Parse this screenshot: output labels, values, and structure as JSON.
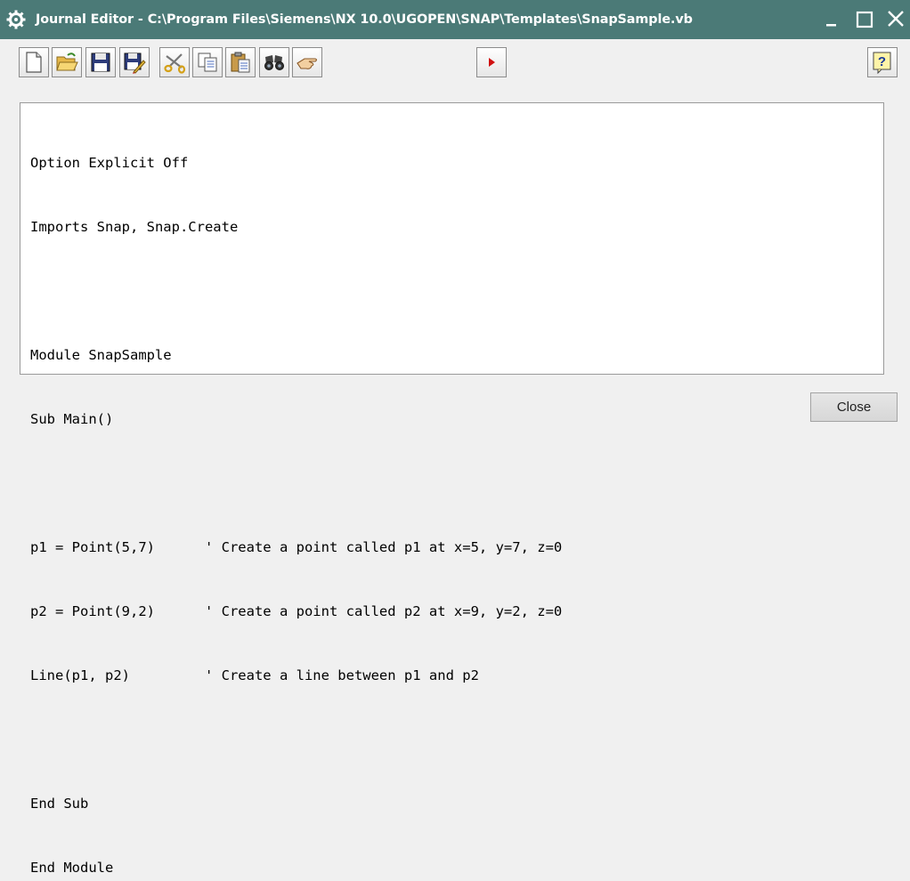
{
  "window": {
    "title": "Journal Editor - C:\\Program Files\\Siemens\\NX 10.0\\UGOPEN\\SNAP\\Templates\\SnapSample.vb",
    "app_icon": "gear-icon",
    "controls": [
      "minimize-icon",
      "maximize-icon",
      "close-icon"
    ],
    "titlebar_color": "#4b7a77"
  },
  "toolbar": {
    "buttons": [
      "new-file-icon",
      "open-folder-icon",
      "save-icon",
      "save-as-icon",
      "cut-icon",
      "copy-icon",
      "paste-icon",
      "find-icon",
      "hand-icon",
      "run-icon"
    ],
    "help_button": "help-icon"
  },
  "editor": {
    "lines": [
      "Option Explicit Off",
      "Imports Snap, Snap.Create",
      "",
      "Module SnapSample",
      "Sub Main()",
      "",
      "p1 = Point(5,7)      ' Create a point called p1 at x=5, y=7, z=0",
      "p2 = Point(9,2)      ' Create a point called p2 at x=9, y=2, z=0",
      "Line(p1, p2)         ' Create a line between p1 and p2",
      "",
      "End Sub",
      "End Module"
    ]
  },
  "footer": {
    "close_label": "Close"
  }
}
